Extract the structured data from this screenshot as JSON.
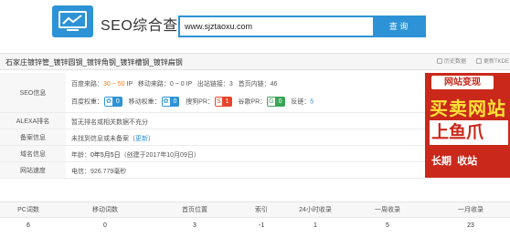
{
  "header": {
    "app_title": "SEO综合查询",
    "search_value": "www.sjztaoxu.com",
    "search_button": "查 询"
  },
  "site_bar": {
    "title": "石家庄镀锌管_镀锌圆钢_镀锌角钢_镀锌槽钢_镀锌扁钢",
    "history_label": "历史数据",
    "update_label": "更新TKDE"
  },
  "seo": {
    "label": "SEO信息",
    "line1": {
      "baidu_source_label": "百度来路：",
      "baidu_source_value": "30 ~ 50",
      "baidu_source_unit": "IP",
      "mobile_source_label": "移动来路：",
      "mobile_source_value": "0 ~ 0 IP",
      "outbound_label": "出站链接：",
      "outbound_value": "3",
      "homepage_inlinks_label": "首页内链：",
      "homepage_inlinks_value": "46"
    },
    "line2": {
      "baidu_weight_label": "百度权重：",
      "baidu_weight_value": "0",
      "mobile_weight_label": "移动权重：",
      "mobile_weight_value": "0",
      "sogou_pr_label": "搜狗PR：",
      "sogou_pr_value": "1",
      "google_pr_label": "谷歌PR：",
      "google_pr_value": "0",
      "backlinks_label": "反链：",
      "backlinks_value": "5"
    }
  },
  "alexa": {
    "label": "ALEXA排名",
    "text": "暂无排名或相关数据不充分"
  },
  "icp": {
    "label": "备案信息",
    "text": "未找到信息或未备案",
    "refresh": "更新"
  },
  "domain": {
    "label": "域名信息",
    "age_label": "年龄：",
    "age_value": "0年5月5日",
    "created": "（创建于2017年10月09日）"
  },
  "speed": {
    "label": "网站速度",
    "text": "电信：926.779毫秒"
  },
  "ad": {
    "top": "网站变现",
    "line1": "买卖网站",
    "line2": "上鱼爪",
    "line3a": "长期",
    "line3b": "收站"
  },
  "table": {
    "headers": [
      "PC词数",
      "移动词数",
      "首页位置",
      "索引",
      "24小时收录",
      "一周收录",
      "一月收录"
    ],
    "values": [
      "6",
      "0",
      "3",
      "-1",
      "1",
      "5",
      "23"
    ]
  },
  "colors": {
    "accent": "#2d93d6",
    "orange": "#f27a16",
    "ad_red": "#c9281a",
    "baidu_badge": "#2d93d6",
    "sogou_badge": "#e8442a",
    "google_badge": "#3aa455"
  }
}
